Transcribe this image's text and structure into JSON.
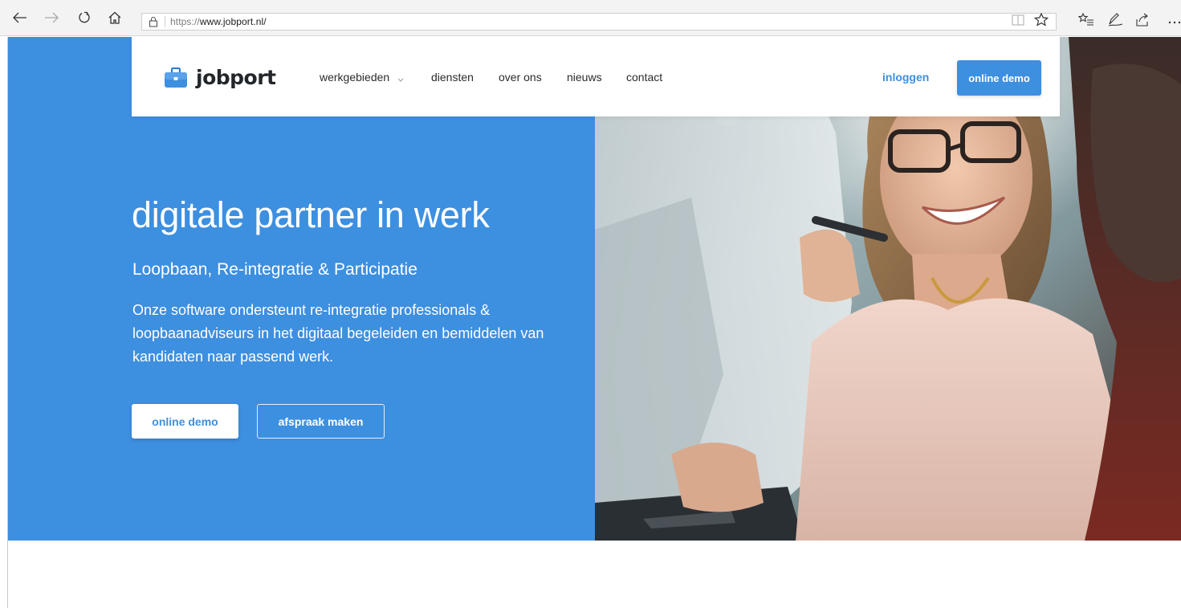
{
  "browser": {
    "url_protocol": "https://",
    "url_host": "www.jobport.nl/"
  },
  "brand": {
    "name": "jobport",
    "accent_color": "#3d8fe0"
  },
  "nav": {
    "items": [
      {
        "label": "werkgebieden",
        "has_dropdown": true
      },
      {
        "label": "diensten"
      },
      {
        "label": "over ons"
      },
      {
        "label": "nieuws"
      },
      {
        "label": "contact"
      }
    ],
    "login_label": "inloggen",
    "demo_label": "online demo"
  },
  "hero": {
    "title": "digitale partner in werk",
    "subtitle": "Loopbaan, Re-integratie & Participatie",
    "description": "Onze software ondersteunt re-integratie professionals & loopbaanadviseurs in het digitaal begeleiden en bemiddelen van kandidaten naar passend werk.",
    "primary_button": "online demo",
    "secondary_button": "afspraak maken"
  },
  "icons": {
    "back": "arrow-left-icon",
    "forward": "arrow-right-icon",
    "refresh": "refresh-icon",
    "home": "home-icon",
    "lock": "lock-icon",
    "reading_view": "book-icon",
    "favorite": "star-icon",
    "favorites_hub": "favorites-list-icon",
    "notes": "pen-icon",
    "share": "share-icon",
    "more": "more-icon",
    "logo": "briefcase-icon"
  }
}
